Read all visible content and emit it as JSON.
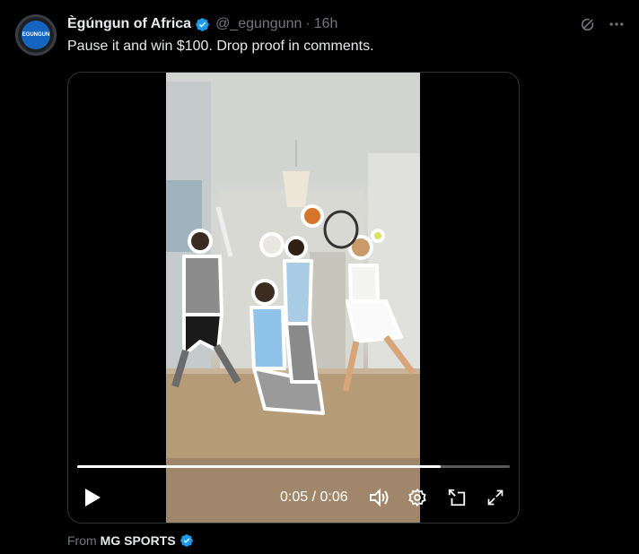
{
  "author": {
    "display_name": "Ègúngun of Africa",
    "handle": "@_egungunn",
    "separator": "·",
    "timestamp": "16h",
    "avatar_text": "EGUNGUN",
    "verified_icon": "verified-badge-icon"
  },
  "tweet": {
    "text": "Pause it and win $100. Drop proof in comments."
  },
  "top_actions": {
    "grok_icon": "grok-icon",
    "more_icon": "more-icon"
  },
  "video": {
    "progress": 0.84,
    "current_time": "0:05",
    "time_separator": "/",
    "duration": "0:06",
    "controls": [
      "play-icon",
      "volume-icon",
      "settings-icon",
      "pip-icon",
      "fullscreen-icon"
    ]
  },
  "source": {
    "prefix": "From",
    "name": "MG SPORTS"
  },
  "colors": {
    "background": "#000000",
    "text_primary": "#e7e9ea",
    "text_secondary": "#71767b",
    "verified_blue": "#1d9bf0",
    "border": "#2f3336"
  }
}
